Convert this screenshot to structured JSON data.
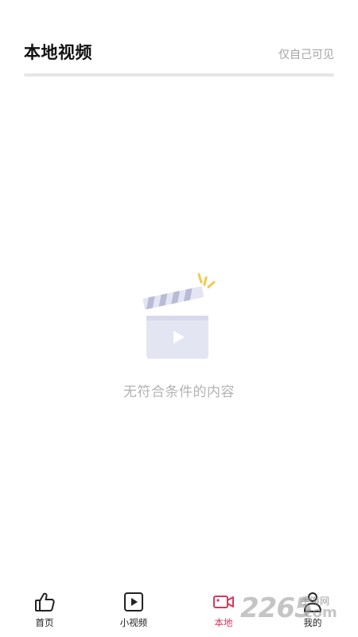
{
  "header": {
    "title": "本地视频",
    "privacy": "仅自己可见"
  },
  "empty_state": {
    "message": "无符合条件的内容",
    "icon": "clapperboard-icon"
  },
  "nav": {
    "items": [
      {
        "label": "首页",
        "icon": "thumbs-up-icon"
      },
      {
        "label": "小视频",
        "icon": "play-box-icon"
      },
      {
        "label": "本地",
        "icon": "video-camera-icon",
        "active": true
      },
      {
        "label": "我的",
        "icon": "user-icon"
      }
    ]
  },
  "watermark": {
    "number": "2265",
    "sub": "手游网",
    "com": "com"
  },
  "colors": {
    "accent": "#d8385c",
    "muted_text": "#b3b3b3",
    "divider": "#e6e6e6"
  }
}
